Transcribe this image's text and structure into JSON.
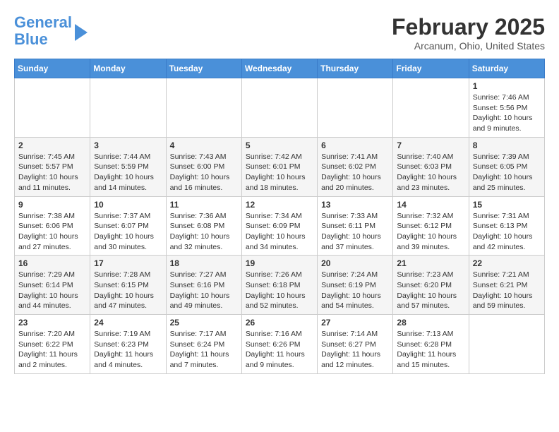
{
  "header": {
    "logo_line1": "General",
    "logo_line2": "Blue",
    "month_title": "February 2025",
    "location": "Arcanum, Ohio, United States"
  },
  "weekdays": [
    "Sunday",
    "Monday",
    "Tuesday",
    "Wednesday",
    "Thursday",
    "Friday",
    "Saturday"
  ],
  "weeks": [
    [
      {
        "day": "",
        "info": ""
      },
      {
        "day": "",
        "info": ""
      },
      {
        "day": "",
        "info": ""
      },
      {
        "day": "",
        "info": ""
      },
      {
        "day": "",
        "info": ""
      },
      {
        "day": "",
        "info": ""
      },
      {
        "day": "1",
        "info": "Sunrise: 7:46 AM\nSunset: 5:56 PM\nDaylight: 10 hours\nand 9 minutes."
      }
    ],
    [
      {
        "day": "2",
        "info": "Sunrise: 7:45 AM\nSunset: 5:57 PM\nDaylight: 10 hours\nand 11 minutes."
      },
      {
        "day": "3",
        "info": "Sunrise: 7:44 AM\nSunset: 5:59 PM\nDaylight: 10 hours\nand 14 minutes."
      },
      {
        "day": "4",
        "info": "Sunrise: 7:43 AM\nSunset: 6:00 PM\nDaylight: 10 hours\nand 16 minutes."
      },
      {
        "day": "5",
        "info": "Sunrise: 7:42 AM\nSunset: 6:01 PM\nDaylight: 10 hours\nand 18 minutes."
      },
      {
        "day": "6",
        "info": "Sunrise: 7:41 AM\nSunset: 6:02 PM\nDaylight: 10 hours\nand 20 minutes."
      },
      {
        "day": "7",
        "info": "Sunrise: 7:40 AM\nSunset: 6:03 PM\nDaylight: 10 hours\nand 23 minutes."
      },
      {
        "day": "8",
        "info": "Sunrise: 7:39 AM\nSunset: 6:05 PM\nDaylight: 10 hours\nand 25 minutes."
      }
    ],
    [
      {
        "day": "9",
        "info": "Sunrise: 7:38 AM\nSunset: 6:06 PM\nDaylight: 10 hours\nand 27 minutes."
      },
      {
        "day": "10",
        "info": "Sunrise: 7:37 AM\nSunset: 6:07 PM\nDaylight: 10 hours\nand 30 minutes."
      },
      {
        "day": "11",
        "info": "Sunrise: 7:36 AM\nSunset: 6:08 PM\nDaylight: 10 hours\nand 32 minutes."
      },
      {
        "day": "12",
        "info": "Sunrise: 7:34 AM\nSunset: 6:09 PM\nDaylight: 10 hours\nand 34 minutes."
      },
      {
        "day": "13",
        "info": "Sunrise: 7:33 AM\nSunset: 6:11 PM\nDaylight: 10 hours\nand 37 minutes."
      },
      {
        "day": "14",
        "info": "Sunrise: 7:32 AM\nSunset: 6:12 PM\nDaylight: 10 hours\nand 39 minutes."
      },
      {
        "day": "15",
        "info": "Sunrise: 7:31 AM\nSunset: 6:13 PM\nDaylight: 10 hours\nand 42 minutes."
      }
    ],
    [
      {
        "day": "16",
        "info": "Sunrise: 7:29 AM\nSunset: 6:14 PM\nDaylight: 10 hours\nand 44 minutes."
      },
      {
        "day": "17",
        "info": "Sunrise: 7:28 AM\nSunset: 6:15 PM\nDaylight: 10 hours\nand 47 minutes."
      },
      {
        "day": "18",
        "info": "Sunrise: 7:27 AM\nSunset: 6:16 PM\nDaylight: 10 hours\nand 49 minutes."
      },
      {
        "day": "19",
        "info": "Sunrise: 7:26 AM\nSunset: 6:18 PM\nDaylight: 10 hours\nand 52 minutes."
      },
      {
        "day": "20",
        "info": "Sunrise: 7:24 AM\nSunset: 6:19 PM\nDaylight: 10 hours\nand 54 minutes."
      },
      {
        "day": "21",
        "info": "Sunrise: 7:23 AM\nSunset: 6:20 PM\nDaylight: 10 hours\nand 57 minutes."
      },
      {
        "day": "22",
        "info": "Sunrise: 7:21 AM\nSunset: 6:21 PM\nDaylight: 10 hours\nand 59 minutes."
      }
    ],
    [
      {
        "day": "23",
        "info": "Sunrise: 7:20 AM\nSunset: 6:22 PM\nDaylight: 11 hours\nand 2 minutes."
      },
      {
        "day": "24",
        "info": "Sunrise: 7:19 AM\nSunset: 6:23 PM\nDaylight: 11 hours\nand 4 minutes."
      },
      {
        "day": "25",
        "info": "Sunrise: 7:17 AM\nSunset: 6:24 PM\nDaylight: 11 hours\nand 7 minutes."
      },
      {
        "day": "26",
        "info": "Sunrise: 7:16 AM\nSunset: 6:26 PM\nDaylight: 11 hours\nand 9 minutes."
      },
      {
        "day": "27",
        "info": "Sunrise: 7:14 AM\nSunset: 6:27 PM\nDaylight: 11 hours\nand 12 minutes."
      },
      {
        "day": "28",
        "info": "Sunrise: 7:13 AM\nSunset: 6:28 PM\nDaylight: 11 hours\nand 15 minutes."
      },
      {
        "day": "",
        "info": ""
      }
    ]
  ]
}
